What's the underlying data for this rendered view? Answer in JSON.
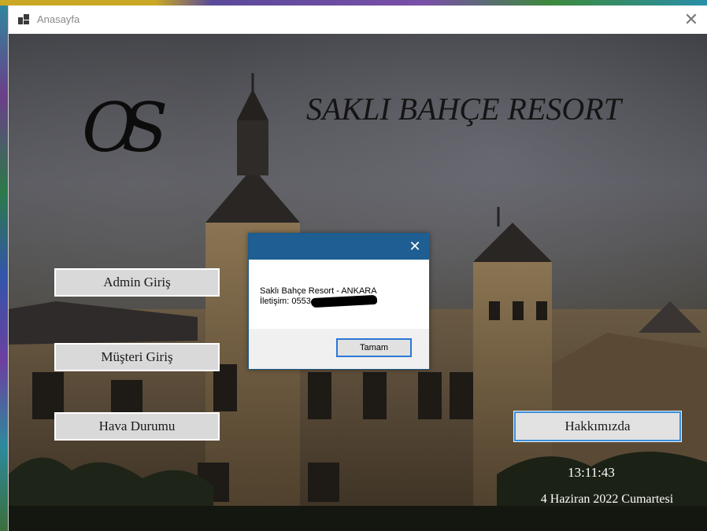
{
  "window": {
    "title": "Anasayfa",
    "close_glyph": "✕"
  },
  "main": {
    "logo_text": "OS",
    "resort_title": "SAKLI BAHÇE RESORT",
    "buttons": {
      "admin": "Admin Giriş",
      "customer": "Müşteri Giriş",
      "weather": "Hava Durumu",
      "about": "Hakkımızda"
    },
    "clock": "13:11:43",
    "date": "4 Haziran 2022 Cumartesi"
  },
  "message_box": {
    "close_glyph": "✕",
    "line1": "Saklı Bahçe Resort - ANKARA",
    "line2": "İletişim: 0553",
    "ok_label": "Tamam"
  },
  "colors": {
    "accent_blue": "#1e5e92",
    "focus_border": "#3d8fd8"
  }
}
